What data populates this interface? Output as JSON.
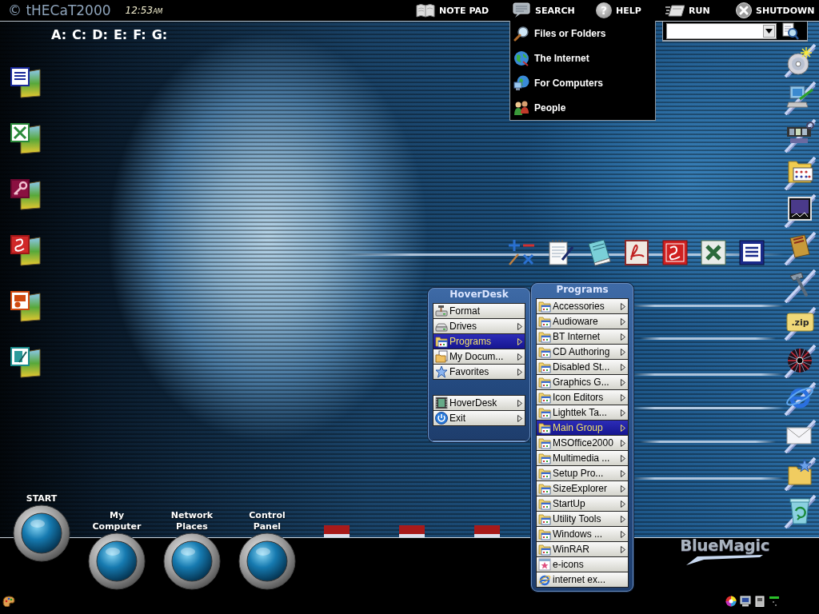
{
  "top_bar": {
    "logo": "© tHECaT2000",
    "clock": {
      "time": "12:53",
      "period": "AM"
    },
    "buttons": [
      {
        "label": "NOTE PAD"
      },
      {
        "label": "SEARCH",
        "menu": [
          {
            "label": "Files or Folders"
          },
          {
            "label": "The Internet"
          },
          {
            "label": "For Computers"
          },
          {
            "label": "People"
          }
        ]
      },
      {
        "label": "HELP",
        "glyph": "?"
      },
      {
        "label": "RUN"
      },
      {
        "label": "SHUTDOWN"
      }
    ]
  },
  "drives": [
    "A:",
    "C:",
    "D:",
    "E:",
    "F:",
    "G:"
  ],
  "right_dock": {
    "zip_label": ".zip"
  },
  "hoverdesk_menu": {
    "title": "HoverDesk",
    "groups": [
      {
        "items": [
          {
            "label": "Format",
            "submenu": false,
            "selected": false
          },
          {
            "label": "Drives",
            "submenu": true,
            "selected": false
          },
          {
            "label": "Programs",
            "submenu": true,
            "selected": true
          },
          {
            "label": "My Docum...",
            "submenu": true,
            "selected": false
          },
          {
            "label": "Favorites",
            "submenu": true,
            "selected": false
          }
        ]
      },
      {
        "items": [
          {
            "label": "HoverDesk",
            "submenu": true,
            "selected": false
          },
          {
            "label": "Exit",
            "submenu": true,
            "selected": false
          }
        ]
      }
    ]
  },
  "programs_menu": {
    "title": "Programs",
    "items": [
      {
        "label": "Accessories",
        "submenu": true,
        "selected": false
      },
      {
        "label": "Audioware",
        "submenu": true,
        "selected": false
      },
      {
        "label": "BT Internet",
        "submenu": true,
        "selected": false
      },
      {
        "label": "CD Authoring",
        "submenu": true,
        "selected": false
      },
      {
        "label": "Disabled St...",
        "submenu": true,
        "selected": false
      },
      {
        "label": "Graphics G...",
        "submenu": true,
        "selected": false
      },
      {
        "label": "Icon Editors",
        "submenu": true,
        "selected": false
      },
      {
        "label": "Lighttek Ta...",
        "submenu": true,
        "selected": false
      },
      {
        "label": "Main Group",
        "submenu": true,
        "selected": true
      },
      {
        "label": "MSOffice2000",
        "submenu": true,
        "selected": false
      },
      {
        "label": "Multimedia ...",
        "submenu": true,
        "selected": false
      },
      {
        "label": "Setup Pro...",
        "submenu": true,
        "selected": false
      },
      {
        "label": "SizeExplorer",
        "submenu": true,
        "selected": false
      },
      {
        "label": "StartUp",
        "submenu": true,
        "selected": false
      },
      {
        "label": "Utility Tools",
        "submenu": true,
        "selected": false
      },
      {
        "label": "Windows ...",
        "submenu": true,
        "selected": false
      },
      {
        "label": "WinRAR",
        "submenu": true,
        "selected": false
      },
      {
        "label": "e-icons",
        "submenu": false,
        "selected": false
      },
      {
        "label": "internet ex...",
        "submenu": false,
        "selected": false
      }
    ]
  },
  "launch_buttons": [
    {
      "label": "START"
    },
    {
      "label": "My Computer"
    },
    {
      "label": "Network Places"
    },
    {
      "label": "Control Panel"
    }
  ],
  "brand": "BlueMagic"
}
